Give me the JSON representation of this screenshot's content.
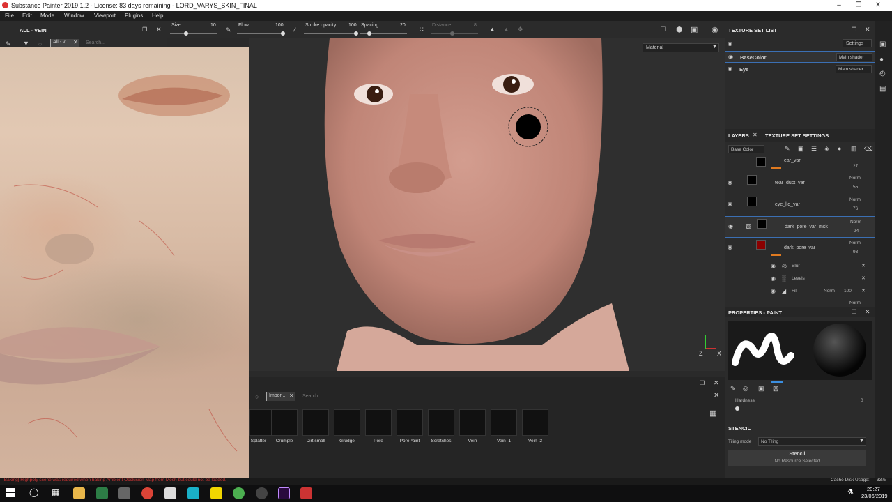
{
  "app": {
    "title": "Substance Painter 2019.1.2 - License: 83 days remaining - LORD_VARYS_SKIN_FINAL"
  },
  "menu": [
    "File",
    "Edit",
    "Mode",
    "Window",
    "Viewport",
    "Plugins",
    "Help"
  ],
  "toolbar": {
    "size_label": "Size",
    "size_value": "10",
    "flow_label": "Flow",
    "flow_value": "100",
    "stroke_label": "Stroke opacity",
    "stroke_value": "100",
    "spacing_label": "Spacing",
    "spacing_value": "20",
    "distance_label": "Distance",
    "distance_value": "8"
  },
  "left": {
    "title": "ALL - VEIN",
    "filter_tag": "All - v...",
    "search_placeholder": "Search..."
  },
  "viewport": {
    "material_select": "Material"
  },
  "shelf": {
    "filter_tag": "Impor...",
    "search_placeholder": "Search...",
    "items": [
      "Splatter",
      "Crumple",
      "Dirt small",
      "Grudge",
      "Pore",
      "PorePaint",
      "Scratches",
      "Vein",
      "Vein_1",
      "Vein_2"
    ]
  },
  "texture_set": {
    "title": "TEXTURE SET LIST",
    "settings": "Settings",
    "rows": [
      {
        "name": "BaseColor",
        "shader": "Main shader"
      },
      {
        "name": "Eye",
        "shader": "Main shader"
      }
    ]
  },
  "layers": {
    "tab1": "LAYERS",
    "tab2": "TEXTURE SET SETTINGS",
    "channel": "Base Color",
    "items": [
      {
        "name": "ear_var",
        "blend": "",
        "opacity": "27"
      },
      {
        "name": "tear_duct_var",
        "blend": "Norm",
        "opacity": "55"
      },
      {
        "name": "eye_lid_var",
        "blend": "Norm",
        "opacity": "76"
      },
      {
        "name": "dark_pore_var_msk",
        "blend": "Norm",
        "opacity": "24"
      },
      {
        "name": "dark_pore_var",
        "blend": "Norm",
        "opacity": "93"
      }
    ],
    "effects": [
      {
        "name": "Blur"
      },
      {
        "name": "Levels"
      },
      {
        "name": "Fill",
        "blend": "Norm",
        "opacity": "100"
      }
    ],
    "last_blend": "Norm"
  },
  "properties": {
    "title": "PROPERTIES - PAINT",
    "hardness_label": "Hardness",
    "hardness_value": "0",
    "stencil_header": "STENCIL",
    "tiling_label": "Tiling mode",
    "tiling_value": "No Tiling",
    "stencil_button": "Stencil",
    "stencil_sub": "No Resource Selected"
  },
  "status": {
    "message": "[Baking] Highpoly scene was required when baking Ambient Occlusion Map from Mesh but could not be loaded.",
    "cache": "Cache Disk Usage:",
    "cache_value": "33%"
  },
  "taskbar": {
    "time": "20:27",
    "date": "23/06/2019"
  },
  "axis": {
    "x": "X",
    "z": "Z"
  }
}
